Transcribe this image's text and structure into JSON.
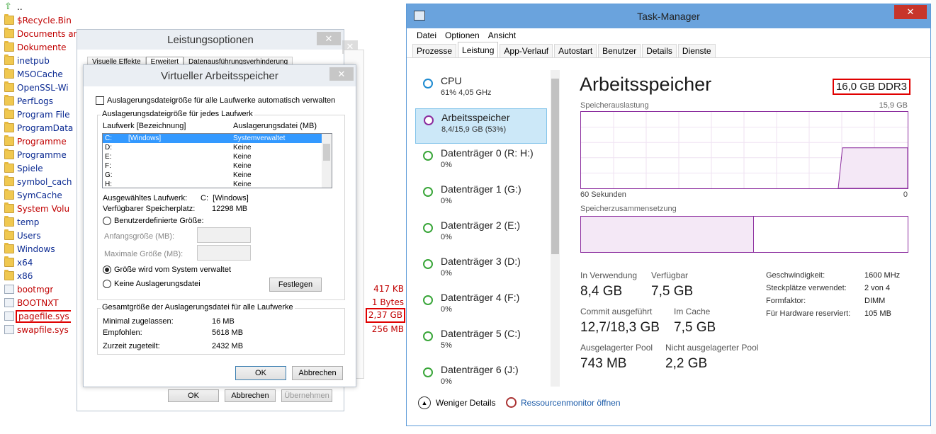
{
  "explorer": {
    "items": [
      {
        "name": "..",
        "type": "up",
        "color": "black"
      },
      {
        "name": "$Recycle.Bin",
        "type": "folder",
        "color": "red"
      },
      {
        "name": "Documents and",
        "type": "folder",
        "color": "red"
      },
      {
        "name": "Dokumente",
        "type": "folder",
        "color": "red"
      },
      {
        "name": "inetpub",
        "type": "folder",
        "color": "blue"
      },
      {
        "name": "MSOCache",
        "type": "folder",
        "color": "blue"
      },
      {
        "name": "OpenSSL-Wi",
        "type": "folder",
        "color": "blue"
      },
      {
        "name": "PerfLogs",
        "type": "folder",
        "color": "blue"
      },
      {
        "name": "Program File",
        "type": "folder",
        "color": "blue"
      },
      {
        "name": "ProgramData",
        "type": "folder",
        "color": "blue"
      },
      {
        "name": "Programme",
        "type": "folder",
        "color": "red"
      },
      {
        "name": "Programme",
        "type": "folder",
        "color": "blue"
      },
      {
        "name": "Spiele",
        "type": "folder",
        "color": "blue"
      },
      {
        "name": "symbol_cach",
        "type": "folder",
        "color": "blue"
      },
      {
        "name": "SymCache",
        "type": "folder",
        "color": "blue"
      },
      {
        "name": "System Volu",
        "type": "folder",
        "color": "red"
      },
      {
        "name": "temp",
        "type": "folder",
        "color": "blue"
      },
      {
        "name": "Users",
        "type": "folder",
        "color": "blue"
      },
      {
        "name": "Windows",
        "type": "folder",
        "color": "blue"
      },
      {
        "name": "x64",
        "type": "folder",
        "color": "blue"
      },
      {
        "name": "x86",
        "type": "folder",
        "color": "blue"
      },
      {
        "name": "bootmgr",
        "type": "file",
        "color": "red"
      },
      {
        "name": "BOOTNXT",
        "type": "file",
        "color": "red"
      },
      {
        "name": "pagefile.sys",
        "type": "file",
        "color": "red"
      },
      {
        "name": "swapfile.sys",
        "type": "file",
        "color": "red"
      }
    ],
    "sizes": {
      "bootmgr": "417 KB",
      "bootnxt": "1 Bytes",
      "pagefile": "2,37 GB",
      "swapfile": "256 MB"
    }
  },
  "leistung": {
    "title": "Leistungsoptionen",
    "close": "✕",
    "tabs": [
      "Visuelle Effekte",
      "Erweitert",
      "Datenausführungsverhinderung"
    ],
    "buttons": {
      "ok": "OK",
      "cancel": "Abbrechen",
      "apply": "Übernehmen"
    }
  },
  "virtual": {
    "title": "Virtueller Arbeitsspeicher",
    "close": "✕",
    "auto_checkbox": "Auslagerungsdateigröße für alle Laufwerke automatisch verwalten",
    "group_title": "Auslagerungsdateigröße für jedes Laufwerk",
    "col_drive": "Laufwerk [Bezeichnung]",
    "col_file": "Auslagerungsdatei (MB)",
    "drives": [
      {
        "drive": "C:",
        "label": "[Windows]",
        "value": "Systemverwaltet"
      },
      {
        "drive": "D:",
        "label": "",
        "value": "Keine"
      },
      {
        "drive": "E:",
        "label": "",
        "value": "Keine"
      },
      {
        "drive": "F:",
        "label": "",
        "value": "Keine"
      },
      {
        "drive": "G:",
        "label": "",
        "value": "Keine"
      },
      {
        "drive": "H:",
        "label": "",
        "value": "Keine"
      }
    ],
    "selected_drive_label": "Ausgewähltes Laufwerk:",
    "selected_drive_value": "C:  [Windows]",
    "free_space_label": "Verfügbarer Speicherplatz:",
    "free_space_value": "12298 MB",
    "radio_custom": "Benutzerdefinierte Größe:",
    "initial_size": "Anfangsgröße (MB):",
    "max_size": "Maximale Größe (MB):",
    "radio_system": "Größe wird vom System verwaltet",
    "radio_none": "Keine Auslagerungsdatei",
    "set_button": "Festlegen",
    "total_group": "Gesamtgröße der Auslagerungsdatei für alle Laufwerke",
    "min_label": "Minimal zugelassen:",
    "min_value": "16 MB",
    "rec_label": "Empfohlen:",
    "rec_value": "5618 MB",
    "cur_label": "Zurzeit zugeteilt:",
    "cur_value": "2432 MB",
    "ok": "OK",
    "cancel": "Abbrechen"
  },
  "taskmgr": {
    "title": "Task-Manager",
    "close": "✕",
    "menu": [
      "Datei",
      "Optionen",
      "Ansicht"
    ],
    "tabs": [
      "Prozesse",
      "Leistung",
      "App-Verlauf",
      "Autostart",
      "Benutzer",
      "Details",
      "Dienste"
    ],
    "active_tab": "Leistung",
    "sidebar": [
      {
        "name": "CPU",
        "detail": "61% 4,05 GHz",
        "color": "#1d8ad0"
      },
      {
        "name": "Arbeitsspeicher",
        "detail": "8,4/15,9 GB (53%)",
        "color": "#8b2c9e"
      },
      {
        "name": "Datenträger 0 (R: H:)",
        "detail": "0%",
        "color": "#3aa63a"
      },
      {
        "name": "Datenträger 1 (G:)",
        "detail": "0%",
        "color": "#3aa63a"
      },
      {
        "name": "Datenträger 2 (E:)",
        "detail": "0%",
        "color": "#3aa63a"
      },
      {
        "name": "Datenträger 3 (D:)",
        "detail": "0%",
        "color": "#3aa63a"
      },
      {
        "name": "Datenträger 4 (F:)",
        "detail": "0%",
        "color": "#3aa63a"
      },
      {
        "name": "Datenträger 5 (C:)",
        "detail": "5%",
        "color": "#3aa63a"
      },
      {
        "name": "Datenträger 6 (J:)",
        "detail": "0%",
        "color": "#3aa63a"
      }
    ],
    "heading": "Arbeitsspeicher",
    "memory_type": "16,0 GB DDR3",
    "usage_label": "Speicherauslastung",
    "usage_max": "15,9 GB",
    "time_left": "60 Sekunden",
    "time_right": "0",
    "composition_label": "Speicherzusammensetzung",
    "in_use_fraction": 0.53,
    "stats": {
      "in_use_label": "In Verwendung",
      "in_use": "8,4 GB",
      "available_label": "Verfügbar",
      "available": "7,5 GB",
      "commit_label": "Commit ausgeführt",
      "commit": "12,7/18,3 GB",
      "cached_label": "Im Cache",
      "cached": "7,5 GB",
      "paged_label": "Ausgelagerter Pool",
      "paged": "743 MB",
      "nonpaged_label": "Nicht ausgelagerter Pool",
      "nonpaged": "2,2 GB"
    },
    "info": {
      "speed_label": "Geschwindigkeit:",
      "speed": "1600 MHz",
      "slots_label": "Steckplätze verwendet:",
      "slots": "2 von 4",
      "form_label": "Formfaktor:",
      "form": "DIMM",
      "reserved_label": "Für Hardware reserviert:",
      "reserved": "105 MB"
    },
    "fewer_details": "Weniger Details",
    "resmon": "Ressourcenmonitor öffnen"
  },
  "colors": {
    "accent_red": "#e00000",
    "tm_title": "#6aa3dd",
    "memory_purple": "#8b2c9e",
    "selection": "#3399ff"
  }
}
